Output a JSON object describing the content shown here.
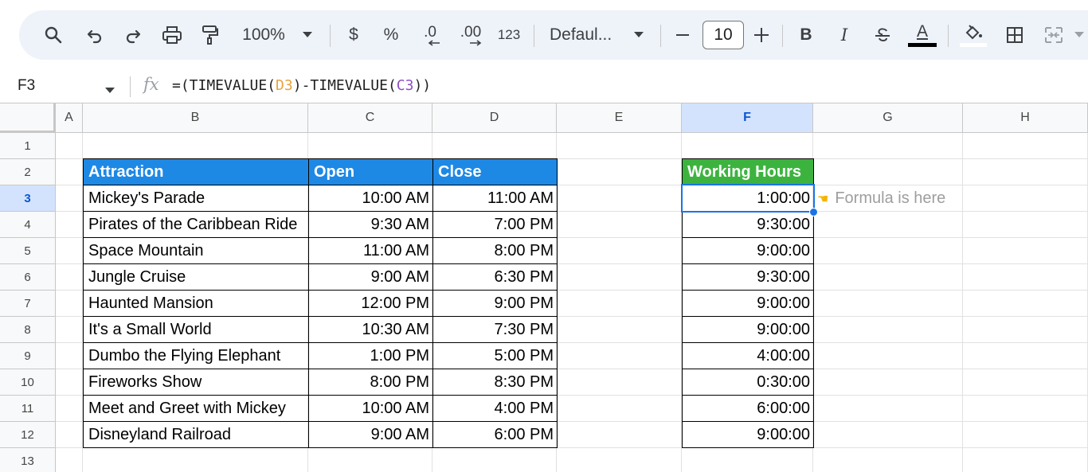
{
  "toolbar": {
    "zoom": "100%",
    "currency": "$",
    "percent": "%",
    "decrease_decimal": ".0",
    "increase_decimal": ".00",
    "number_format": "123",
    "font": "Defaul...",
    "font_size": "10",
    "bold": "B",
    "italic": "I",
    "text_color_letter": "A",
    "icons": [
      "search-icon",
      "undo-icon",
      "redo-icon",
      "print-icon",
      "paint-format-icon",
      "chevron-down-icon",
      "minus-icon",
      "plus-icon",
      "strikethrough-icon",
      "fill-color-icon",
      "borders-icon",
      "merge-cells-icon"
    ]
  },
  "formula_bar": {
    "name_box": "F3",
    "fx": "fx",
    "formula_prefix": "=(TIMEVALUE(",
    "ref1": "D3",
    "formula_mid": ")-TIMEVALUE(",
    "ref2": "C3",
    "formula_suffix": "))"
  },
  "grid": {
    "columns": [
      "A",
      "B",
      "C",
      "D",
      "E",
      "F",
      "G",
      "H"
    ],
    "active_column": "F",
    "rows": [
      "1",
      "2",
      "3",
      "4",
      "5",
      "6",
      "7",
      "8",
      "9",
      "10",
      "11",
      "12",
      "13"
    ],
    "active_row": "3"
  },
  "table": {
    "headers": {
      "attraction": "Attraction",
      "open": "Open",
      "close": "Close",
      "working_hours": "Working Hours"
    },
    "rows": [
      {
        "attraction": "Mickey's Parade",
        "open": "10:00 AM",
        "close": "11:00 AM",
        "hours": "1:00:00"
      },
      {
        "attraction": "Pirates of the Caribbean Ride",
        "open": "9:30 AM",
        "close": "7:00 PM",
        "hours": "9:30:00"
      },
      {
        "attraction": "Space Mountain",
        "open": "11:00 AM",
        "close": "8:00 PM",
        "hours": "9:00:00"
      },
      {
        "attraction": "Jungle Cruise",
        "open": "9:00 AM",
        "close": "6:30 PM",
        "hours": "9:30:00"
      },
      {
        "attraction": "Haunted Mansion",
        "open": "12:00 PM",
        "close": "9:00 PM",
        "hours": "9:00:00"
      },
      {
        "attraction": "It's a Small World",
        "open": "10:30 AM",
        "close": "7:30 PM",
        "hours": "9:00:00"
      },
      {
        "attraction": "Dumbo the Flying Elephant",
        "open": "1:00 PM",
        "close": "5:00 PM",
        "hours": "4:00:00"
      },
      {
        "attraction": "Fireworks Show",
        "open": "8:00 PM",
        "close": "8:30 PM",
        "hours": "0:30:00"
      },
      {
        "attraction": "Meet and Greet with Mickey",
        "open": "10:00 AM",
        "close": "4:00 PM",
        "hours": "6:00:00"
      },
      {
        "attraction": "Disneyland Railroad",
        "open": "9:00 AM",
        "close": "6:00 PM",
        "hours": "9:00:00"
      }
    ]
  },
  "note": {
    "icon": "pointing-hand-icon",
    "text": "Formula is here"
  },
  "colors": {
    "header_blue": "#1e88e5",
    "header_green": "#3db33f",
    "selection": "#1a73e8"
  }
}
